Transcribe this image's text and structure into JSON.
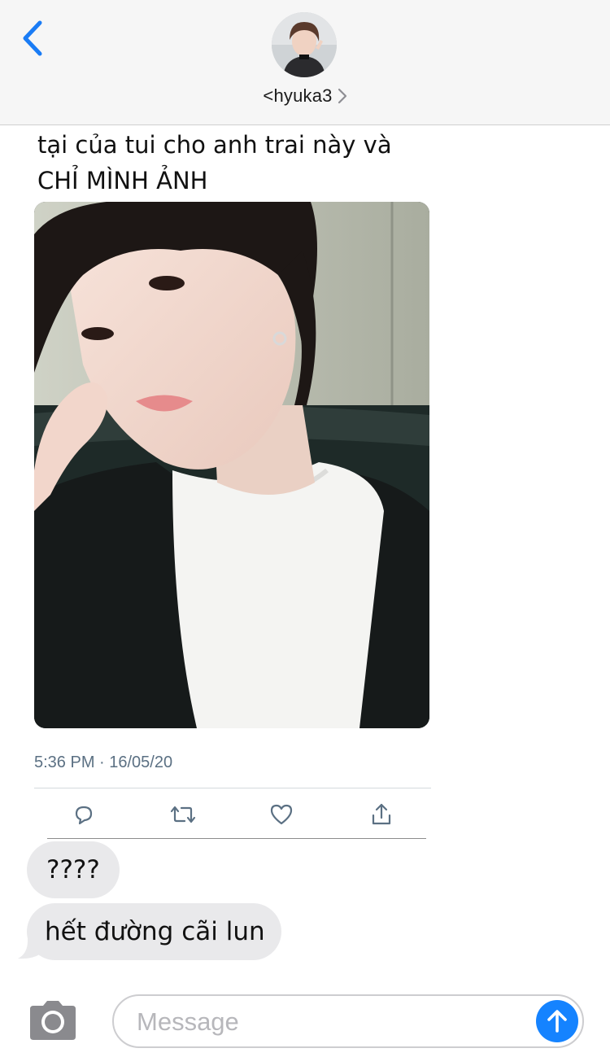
{
  "header": {
    "contact_name": "<hyuka3",
    "back_icon": "chevron-left-icon",
    "chevron_icon": "chevron-right-icon"
  },
  "tweet": {
    "text_line_1": "tại của tui cho anh trai này và",
    "text_line_2": "CHỈ MÌNH ẢNH",
    "timestamp": "5:36 PM · 16/05/20",
    "actions": [
      "reply-icon",
      "retweet-icon",
      "like-icon",
      "share-icon"
    ]
  },
  "messages": [
    {
      "text": "????"
    },
    {
      "text": "hết đường cãi lun"
    }
  ],
  "composer": {
    "placeholder": "Message",
    "camera_icon": "camera-icon",
    "send_icon": "send-arrow-icon"
  },
  "colors": {
    "accent": "#1583ff",
    "bubble_incoming": "#e9e9eb",
    "header_bg": "#f6f6f6",
    "tweet_meta": "#5b7083"
  }
}
